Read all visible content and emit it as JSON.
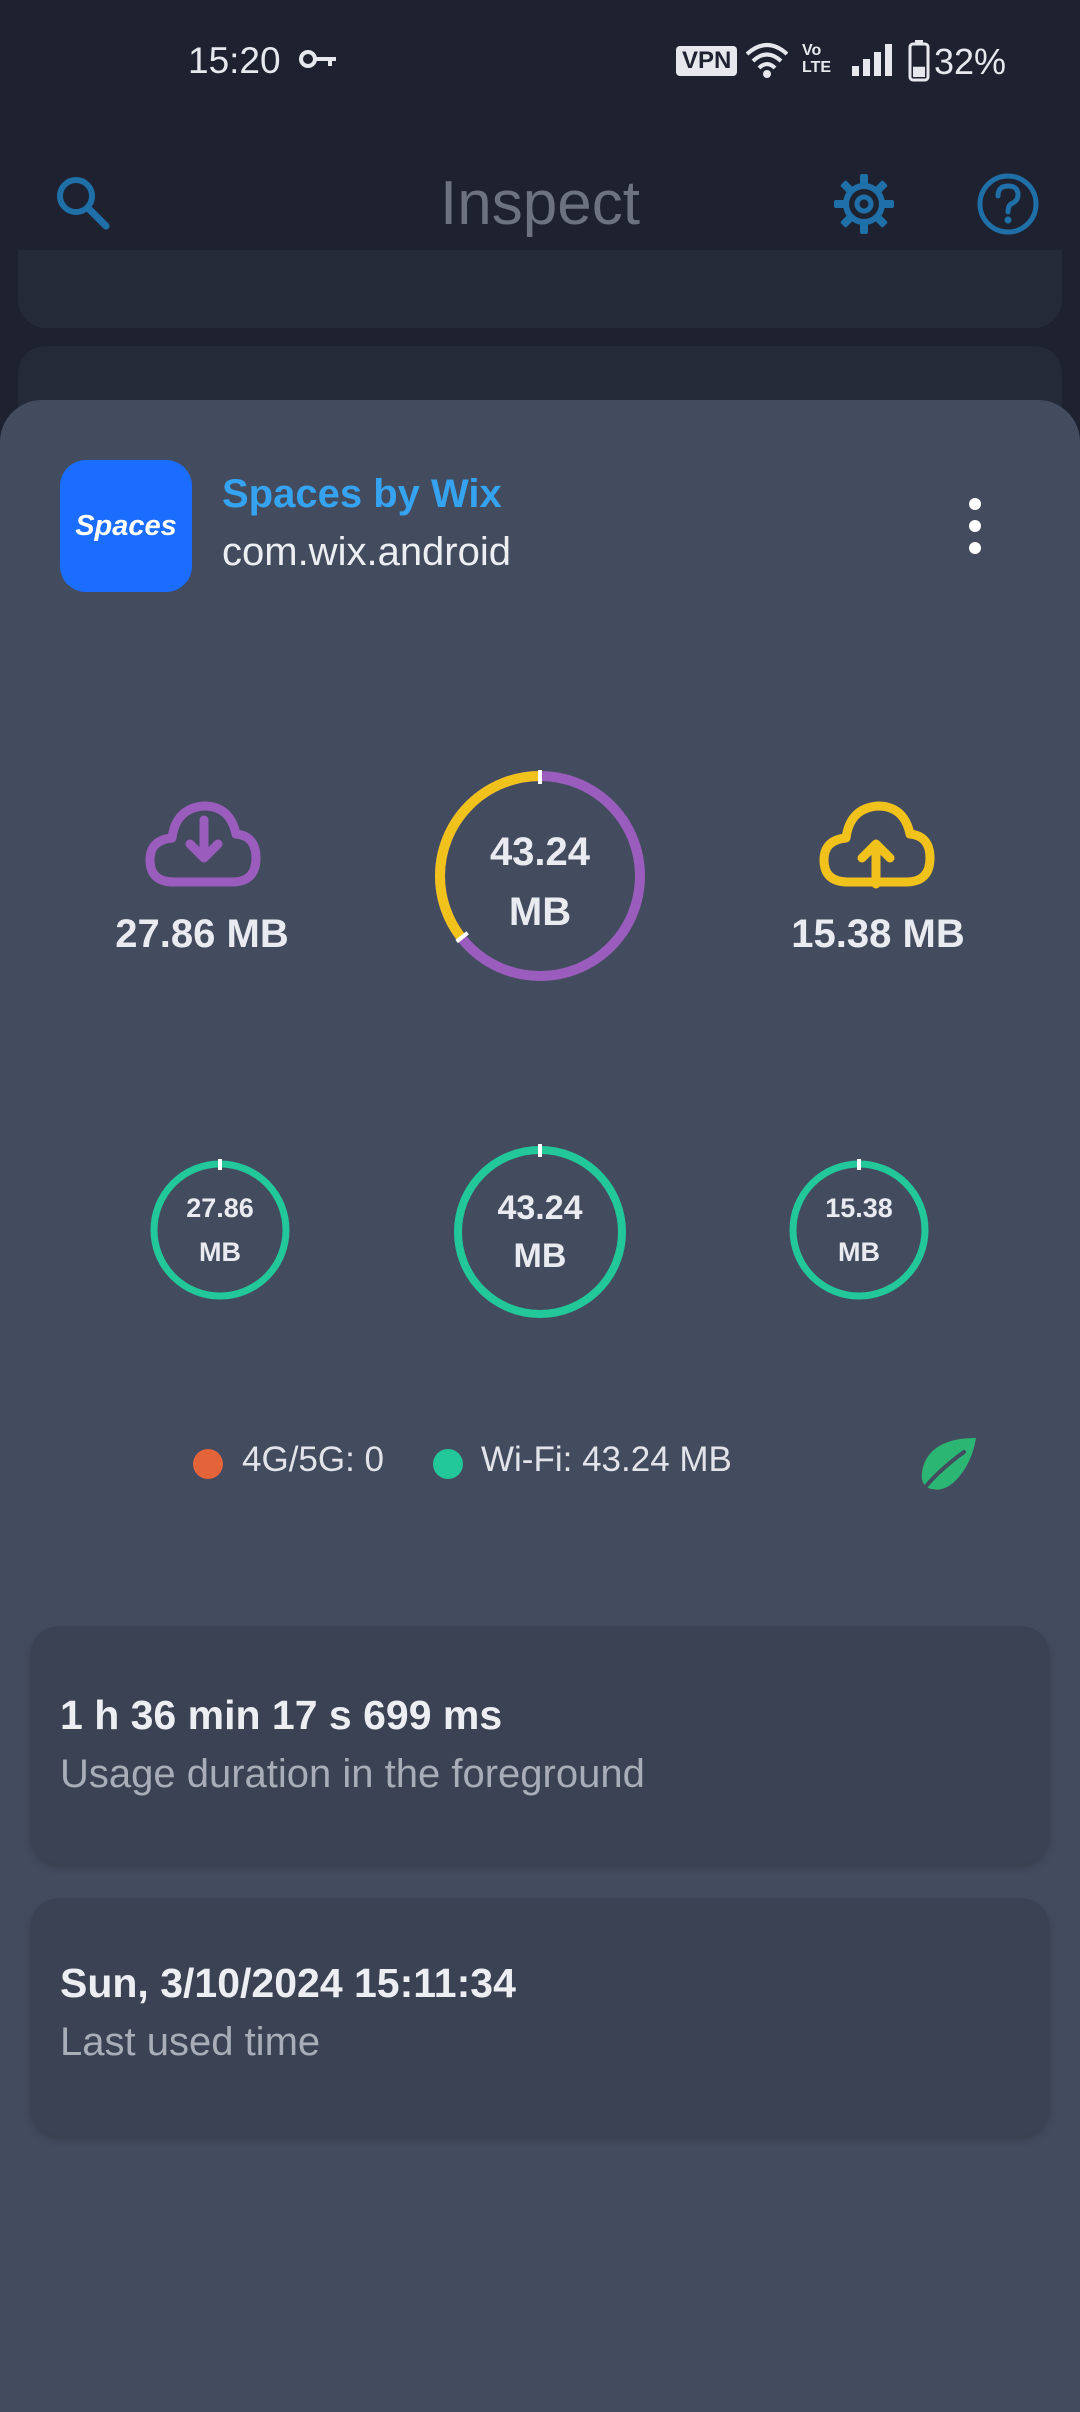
{
  "status_bar": {
    "time": "15:20",
    "vpn_label": "VPN",
    "volte_top": "Vo",
    "volte_bottom": "LTE",
    "battery_percent": "32%",
    "battery_level": 0.32,
    "icons": [
      "key-icon",
      "wifi-icon",
      "volte-icon",
      "signal-icon",
      "battery-icon"
    ]
  },
  "app_bar": {
    "title": "Inspect",
    "icons": [
      "search-icon",
      "gear-icon",
      "help-icon"
    ],
    "icon_color": "#1f6fa8"
  },
  "app": {
    "icon_text": "Spaces",
    "name": "Spaces by Wix",
    "package": "com.wix.android",
    "icon_color": "#1a6dff",
    "name_color": "#35a3f0"
  },
  "traffic": {
    "download": "27.86 MB",
    "upload": "15.38 MB",
    "total_line1": "43.24",
    "total_line2": "MB",
    "download_color": "#9a5dbd",
    "upload_color": "#f1c21b",
    "download_fraction": 0.644,
    "upload_fraction": 0.356
  },
  "network_rings": {
    "left": {
      "line1": "27.86",
      "line2": "MB"
    },
    "center": {
      "line1": "43.24",
      "line2": "MB"
    },
    "right": {
      "line1": "15.38",
      "line2": "MB"
    },
    "ring_color": "#22c89a"
  },
  "legend": {
    "mobile": "4G/5G: 0",
    "wifi": "Wi-Fi: 43.24 MB",
    "mobile_color": "#e4643a",
    "wifi_color": "#22c89a"
  },
  "cards": [
    {
      "value": "1 h 36 min 17 s 699 ms",
      "label": "Usage duration in the foreground"
    },
    {
      "value": "Sun, 3/10/2024 15:11:34",
      "label": "Last used time"
    }
  ]
}
